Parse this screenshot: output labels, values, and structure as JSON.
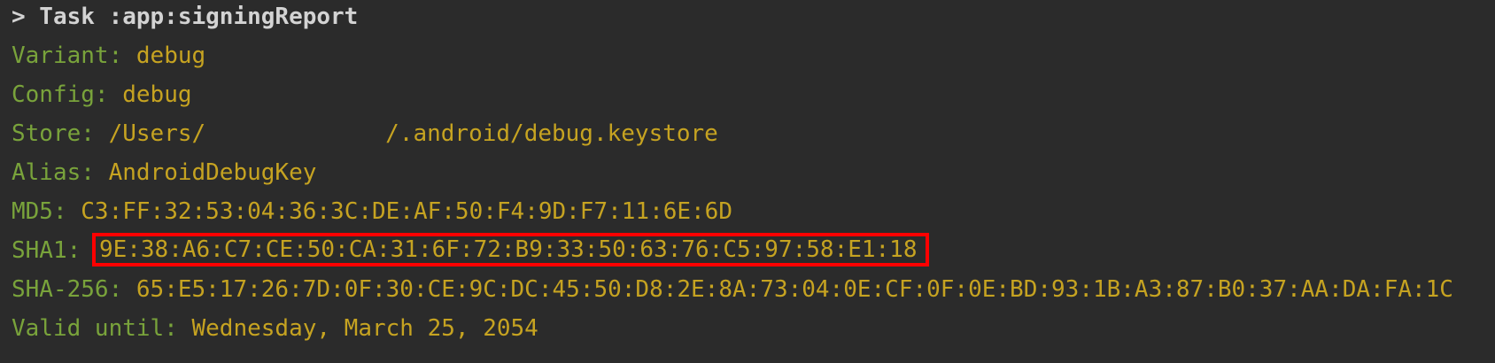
{
  "task": {
    "header": "> Task :app:signingReport"
  },
  "report": {
    "variant": {
      "label": "Variant:",
      "value": "debug"
    },
    "config": {
      "label": "Config:",
      "value": "debug"
    },
    "store": {
      "label": "Store:",
      "value_prefix": "/Users/",
      "value_suffix": "/.android/debug.keystore"
    },
    "alias": {
      "label": "Alias:",
      "value": "AndroidDebugKey"
    },
    "md5": {
      "label": "MD5:",
      "value": "C3:FF:32:53:04:36:3C:DE:AF:50:F4:9D:F7:11:6E:6D"
    },
    "sha1": {
      "label": "SHA1:",
      "value": "9E:38:A6:C7:CE:50:CA:31:6F:72:B9:33:50:63:76:C5:97:58:E1:18"
    },
    "sha256": {
      "label": "SHA-256:",
      "value": "65:E5:17:26:7D:0F:30:CE:9C:DC:45:50:D8:2E:8A:73:04:0E:CF:0F:0E:BD:93:1B:A3:87:B0:37:AA:DA:FA:1C"
    },
    "valid_until": {
      "label": "Valid until:",
      "value": "Wednesday, March 25, 2054"
    }
  },
  "colors": {
    "background": "#2b2b2b",
    "header_text": "#d3d3d3",
    "label_text": "#79a33b",
    "value_text": "#c6a321",
    "highlight_border": "#ff0000"
  }
}
